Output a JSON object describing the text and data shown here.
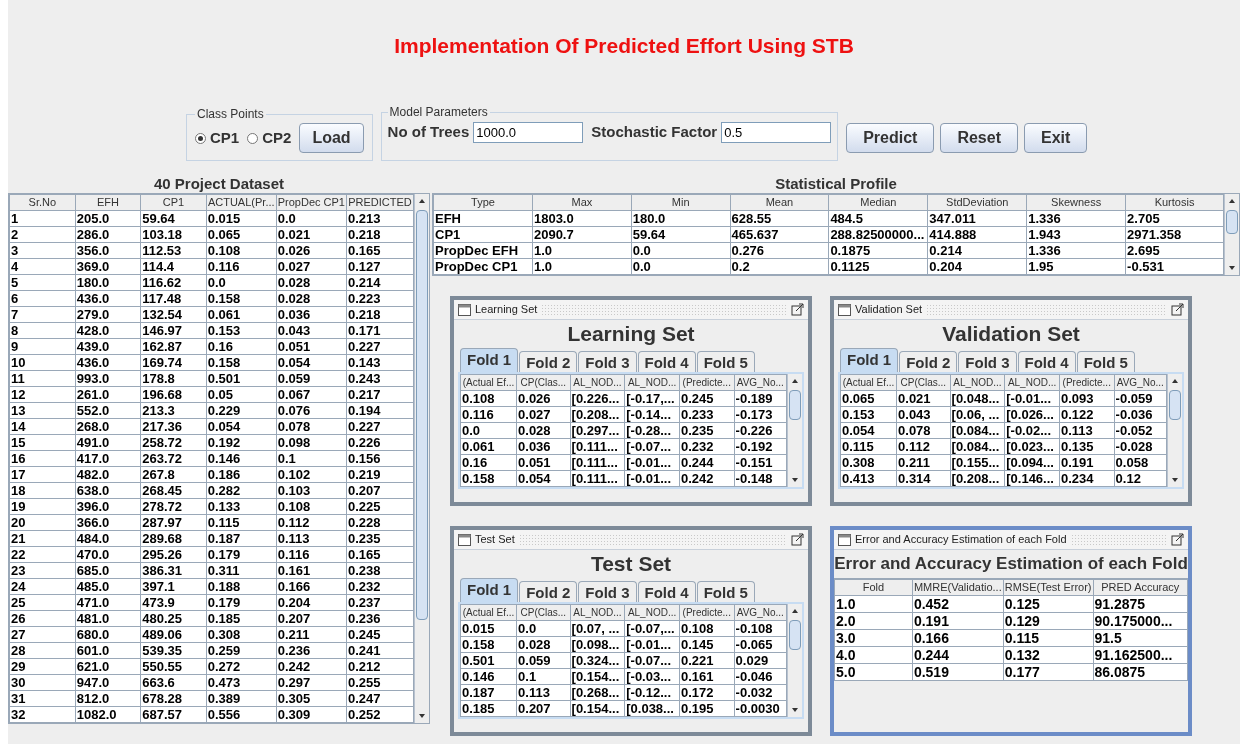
{
  "title": "Implementation Of Predicted Effort Using STB",
  "class_points": {
    "legend": "Class Points",
    "options": [
      {
        "label": "CP1",
        "selected": true
      },
      {
        "label": "CP2",
        "selected": false
      }
    ],
    "button": "Load"
  },
  "model_parameters": {
    "legend": "Model Parameters",
    "fields": [
      {
        "label": "No of Trees",
        "value": "1000.0"
      },
      {
        "label": "Stochastic Factor",
        "value": "0.5"
      }
    ]
  },
  "buttons": [
    "Predict",
    "Reset",
    "Exit"
  ],
  "dataset": {
    "title": "40 Project Dataset",
    "columns": [
      "Sr.No",
      "EFH",
      "CP1",
      "ACTUAL(Pr...",
      "PropDec CP1",
      "PREDICTED"
    ],
    "rows": [
      [
        "1",
        "205.0",
        "59.64",
        "0.015",
        "0.0",
        "0.213"
      ],
      [
        "2",
        "286.0",
        "103.18",
        "0.065",
        "0.021",
        "0.218"
      ],
      [
        "3",
        "356.0",
        "112.53",
        "0.108",
        "0.026",
        "0.165"
      ],
      [
        "4",
        "369.0",
        "114.4",
        "0.116",
        "0.027",
        "0.127"
      ],
      [
        "5",
        "180.0",
        "116.62",
        "0.0",
        "0.028",
        "0.214"
      ],
      [
        "6",
        "436.0",
        "117.48",
        "0.158",
        "0.028",
        "0.223"
      ],
      [
        "7",
        "279.0",
        "132.54",
        "0.061",
        "0.036",
        "0.218"
      ],
      [
        "8",
        "428.0",
        "146.97",
        "0.153",
        "0.043",
        "0.171"
      ],
      [
        "9",
        "439.0",
        "162.87",
        "0.16",
        "0.051",
        "0.227"
      ],
      [
        "10",
        "436.0",
        "169.74",
        "0.158",
        "0.054",
        "0.143"
      ],
      [
        "11",
        "993.0",
        "178.8",
        "0.501",
        "0.059",
        "0.243"
      ],
      [
        "12",
        "261.0",
        "196.68",
        "0.05",
        "0.067",
        "0.217"
      ],
      [
        "13",
        "552.0",
        "213.3",
        "0.229",
        "0.076",
        "0.194"
      ],
      [
        "14",
        "268.0",
        "217.36",
        "0.054",
        "0.078",
        "0.227"
      ],
      [
        "15",
        "491.0",
        "258.72",
        "0.192",
        "0.098",
        "0.226"
      ],
      [
        "16",
        "417.0",
        "263.72",
        "0.146",
        "0.1",
        "0.156"
      ],
      [
        "17",
        "482.0",
        "267.8",
        "0.186",
        "0.102",
        "0.219"
      ],
      [
        "18",
        "638.0",
        "268.45",
        "0.282",
        "0.103",
        "0.207"
      ],
      [
        "19",
        "396.0",
        "278.72",
        "0.133",
        "0.108",
        "0.225"
      ],
      [
        "20",
        "366.0",
        "287.97",
        "0.115",
        "0.112",
        "0.228"
      ],
      [
        "21",
        "484.0",
        "289.68",
        "0.187",
        "0.113",
        "0.235"
      ],
      [
        "22",
        "470.0",
        "295.26",
        "0.179",
        "0.116",
        "0.165"
      ],
      [
        "23",
        "685.0",
        "386.31",
        "0.311",
        "0.161",
        "0.238"
      ],
      [
        "24",
        "485.0",
        "397.1",
        "0.188",
        "0.166",
        "0.232"
      ],
      [
        "25",
        "471.0",
        "473.9",
        "0.179",
        "0.204",
        "0.237"
      ],
      [
        "26",
        "481.0",
        "480.25",
        "0.185",
        "0.207",
        "0.236"
      ],
      [
        "27",
        "680.0",
        "489.06",
        "0.308",
        "0.211",
        "0.245"
      ],
      [
        "28",
        "601.0",
        "539.35",
        "0.259",
        "0.236",
        "0.241"
      ],
      [
        "29",
        "621.0",
        "550.55",
        "0.272",
        "0.242",
        "0.212"
      ],
      [
        "30",
        "947.0",
        "663.6",
        "0.473",
        "0.297",
        "0.255"
      ],
      [
        "31",
        "812.0",
        "678.28",
        "0.389",
        "0.305",
        "0.247"
      ],
      [
        "32",
        "1082.0",
        "687.57",
        "0.556",
        "0.309",
        "0.252"
      ]
    ]
  },
  "statistical_profile": {
    "title": "Statistical Profile",
    "columns": [
      "Type",
      "Max",
      "Min",
      "Mean",
      "Median",
      "StdDeviation",
      "Skewness",
      "Kurtosis"
    ],
    "rows": [
      [
        "EFH",
        "1803.0",
        "180.0",
        "628.55",
        "484.5",
        "347.011",
        "1.336",
        "2.705"
      ],
      [
        "CP1",
        "2090.7",
        "59.64",
        "465.637",
        "288.82500000...",
        "414.888",
        "1.943",
        "2971.358"
      ],
      [
        "PropDec EFH",
        "1.0",
        "0.0",
        "0.276",
        "0.1875",
        "0.214",
        "1.336",
        "2.695"
      ],
      [
        "PropDec CP1",
        "1.0",
        "0.0",
        "0.2",
        "0.1125",
        "0.204",
        "1.95",
        "-0.531"
      ]
    ]
  },
  "frames": [
    {
      "kind": "folds",
      "window_title": "Learning Set",
      "selected": false,
      "heading": "Learning Set",
      "tabs": [
        {
          "label": "Fold 1",
          "selected": true
        },
        {
          "label": "Fold 2",
          "selected": false
        },
        {
          "label": "Fold 3",
          "selected": false
        },
        {
          "label": "Fold 4",
          "selected": false
        },
        {
          "label": "Fold 5",
          "selected": false
        }
      ],
      "columns": [
        "(Actual Ef...",
        "CP(Clas...",
        "AL_NOD...",
        "AL_NOD...",
        "(Predicte...",
        "AVG_No..."
      ],
      "rows": [
        [
          "0.108",
          "0.026",
          "[0.226...",
          "[-0.17,...",
          "0.245",
          "-0.189"
        ],
        [
          "0.116",
          "0.027",
          "[0.208...",
          "[-0.14...",
          "0.233",
          "-0.173"
        ],
        [
          "0.0",
          "0.028",
          "[0.297...",
          "[-0.28...",
          "0.235",
          "-0.226"
        ],
        [
          "0.061",
          "0.036",
          "[0.111...",
          "[-0.07...",
          "0.232",
          "-0.192"
        ],
        [
          "0.16",
          "0.051",
          "[0.111...",
          "[-0.01...",
          "0.244",
          "-0.151"
        ],
        [
          "0.158",
          "0.054",
          "[0.111...",
          "[-0.01...",
          "0.242",
          "-0.148"
        ]
      ]
    },
    {
      "kind": "folds",
      "window_title": "Validation Set",
      "selected": false,
      "heading": "Validation Set",
      "tabs": [
        {
          "label": "Fold 1",
          "selected": true
        },
        {
          "label": "Fold 2",
          "selected": false
        },
        {
          "label": "Fold 3",
          "selected": false
        },
        {
          "label": "Fold 4",
          "selected": false
        },
        {
          "label": "Fold 5",
          "selected": false
        }
      ],
      "columns": [
        "(Actual Ef...",
        "CP(Clas...",
        "AL_NOD...",
        "AL_NOD...",
        "(Predicte...",
        "AVG_No..."
      ],
      "rows": [
        [
          "0.065",
          "0.021",
          "[0.048...",
          "[-0.01...",
          "0.093",
          "-0.059"
        ],
        [
          "0.153",
          "0.043",
          "[0.06, ...",
          "[0.026...",
          "0.122",
          "-0.036"
        ],
        [
          "0.054",
          "0.078",
          "[0.084...",
          "[-0.02...",
          "0.113",
          "-0.052"
        ],
        [
          "0.115",
          "0.112",
          "[0.084...",
          "[0.023...",
          "0.135",
          "-0.028"
        ],
        [
          "0.308",
          "0.211",
          "[0.155...",
          "[0.094...",
          "0.191",
          "0.058"
        ],
        [
          "0.413",
          "0.314",
          "[0.208...",
          "[0.146...",
          "0.234",
          "0.12"
        ]
      ]
    },
    {
      "kind": "folds",
      "window_title": "Test Set",
      "selected": false,
      "heading": "Test Set",
      "tabs": [
        {
          "label": "Fold 1",
          "selected": true
        },
        {
          "label": "Fold 2",
          "selected": false
        },
        {
          "label": "Fold 3",
          "selected": false
        },
        {
          "label": "Fold 4",
          "selected": false
        },
        {
          "label": "Fold 5",
          "selected": false
        }
      ],
      "columns": [
        "(Actual Ef...",
        "CP(Clas...",
        "AL_NOD...",
        "AL_NOD...",
        "(Predicte...",
        "AVG_No..."
      ],
      "rows": [
        [
          "0.015",
          "0.0",
          "[0.07, ...",
          "[-0.07,...",
          "0.108",
          "-0.108"
        ],
        [
          "0.158",
          "0.028",
          "[0.098...",
          "[-0.01...",
          "0.145",
          "-0.065"
        ],
        [
          "0.501",
          "0.059",
          "[0.324...",
          "[-0.07...",
          "0.221",
          "0.029"
        ],
        [
          "0.146",
          "0.1",
          "[0.154...",
          "[-0.03...",
          "0.161",
          "-0.046"
        ],
        [
          "0.187",
          "0.113",
          "[0.268...",
          "[-0.12...",
          "0.172",
          "-0.032"
        ],
        [
          "0.185",
          "0.207",
          "[0.154...",
          "[0.038...",
          "0.195",
          "-0.0030"
        ]
      ]
    },
    {
      "kind": "summary",
      "window_title": "Error and Accuracy Estimation of each Fold",
      "selected": true,
      "heading": "Error and Accuracy Estimation of each Fold",
      "columns": [
        "Fold",
        "MMRE(Validatio...",
        "RMSE(Test Error)",
        "PRED Accuracy"
      ],
      "rows": [
        [
          "1.0",
          "0.452",
          "0.125",
          "91.2875"
        ],
        [
          "2.0",
          "0.191",
          "0.129",
          "90.175000..."
        ],
        [
          "3.0",
          "0.166",
          "0.115",
          "91.5"
        ],
        [
          "4.0",
          "0.244",
          "0.132",
          "91.162500..."
        ],
        [
          "5.0",
          "0.519",
          "0.177",
          "86.0875"
        ]
      ]
    }
  ]
}
